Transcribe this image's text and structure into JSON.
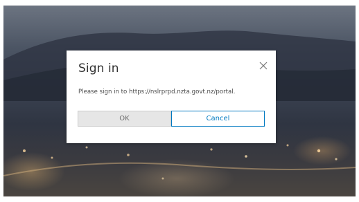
{
  "dialog": {
    "title": "Sign in",
    "message": "Please sign in to https://nslrprpd.nzta.govt.nz/portal.",
    "ok_label": "OK",
    "cancel_label": "Cancel",
    "close_icon": "close-icon"
  },
  "colors": {
    "accent": "#0079c1",
    "ok_background": "#e6e6e6",
    "dialog_background": "#ffffff"
  }
}
